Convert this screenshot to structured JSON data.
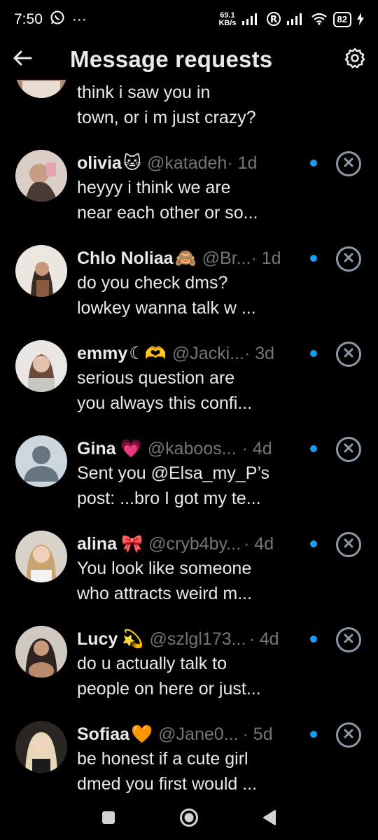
{
  "status_bar": {
    "time": "7:50",
    "more": "···",
    "speed_value": "69.1",
    "speed_unit": "KB/s",
    "battery": "82"
  },
  "header": {
    "title": "Message requests"
  },
  "items": [
    {
      "name": "",
      "emoji": "",
      "handle": "",
      "time": "",
      "preview_line1": "think i saw you in",
      "preview_line2": "town, or i m just crazy?"
    },
    {
      "name": "olivia",
      "emoji": "🐱",
      "handle": "@katadeh",
      "time": "· 1d",
      "preview_line1": "heyyy i think we are",
      "preview_line2": "near each other or so..."
    },
    {
      "name": "Chlo Noliaa",
      "emoji": "🙈",
      "handle": "@Br...",
      "time": "· 1d",
      "preview_line1": "do you check dms?",
      "preview_line2": "lowkey wanna talk w ..."
    },
    {
      "name": "emmy",
      "emoji": "☾🫶",
      "handle": "@Jacki...",
      "time": "· 3d",
      "preview_line1": "serious question are",
      "preview_line2": "you always this confi..."
    },
    {
      "name": "Gina",
      "emoji": "💗",
      "handle": "@kaboos...",
      "time": "· 4d",
      "preview_line1": "Sent you @Elsa_my_P’s",
      "preview_line2": "post: ...bro I got my te..."
    },
    {
      "name": "alina",
      "emoji": "🎀",
      "handle": "@cryb4by...",
      "time": "· 4d",
      "preview_line1": "You look like someone",
      "preview_line2": "who attracts weird m..."
    },
    {
      "name": "Lucy",
      "emoji": "💫",
      "handle": "@szlgl173...",
      "time": "· 4d",
      "preview_line1": "do u actually talk to",
      "preview_line2": "people on here or just..."
    },
    {
      "name": "Sofiaa",
      "emoji": "🧡",
      "handle": "@Jane0...",
      "time": "· 5d",
      "preview_line1": "be honest if a cute girl",
      "preview_line2": "dmed you first would ..."
    }
  ],
  "colors": {
    "accent": "#1d9bf0",
    "muted": "#71767b",
    "text": "#e7e9ea",
    "background": "#000000"
  },
  "icons": {
    "back": "arrow-left-icon",
    "settings": "gear-icon",
    "close": "close-circle-icon",
    "nav_recents": "square-icon",
    "nav_home": "circle-icon",
    "nav_back": "triangle-icon"
  }
}
